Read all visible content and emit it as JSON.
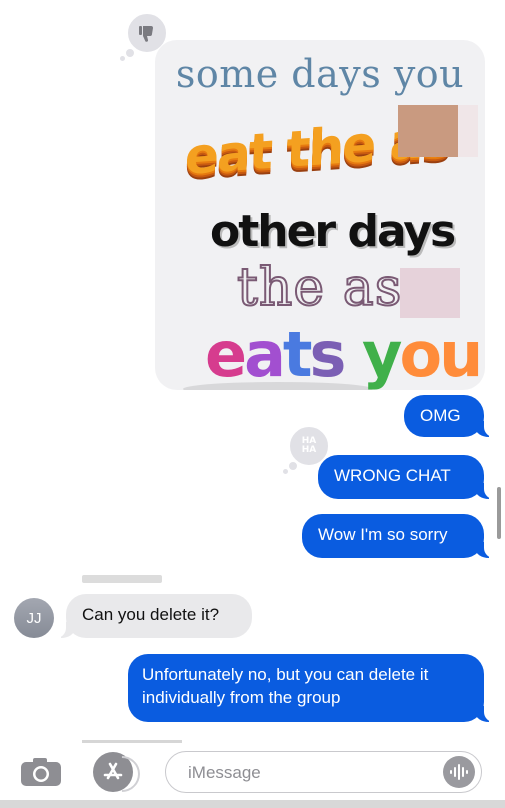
{
  "meme": {
    "line1": "some days you",
    "line2": "eat the as",
    "line3": "other days",
    "line4": "the as",
    "line5": [
      "e",
      "a",
      "t",
      "s",
      " ",
      "y",
      "ou"
    ]
  },
  "tapbacks": {
    "thumbs_down": "thumbs-down",
    "haha_top": "HA",
    "haha_bottom": "HA"
  },
  "messages": {
    "omg": "OMG",
    "wrong_chat": "WRONG CHAT",
    "sorry": "Wow I'm so sorry",
    "delete_question": "Can you delete it?",
    "unfortunately": "Unfortunately no, but you can delete it individually from the group"
  },
  "contact": {
    "initials": "JJ"
  },
  "compose": {
    "placeholder": "iMessage"
  },
  "colors": {
    "sent_bubble": "#0a5ce0",
    "received_bubble": "#e9e9eb",
    "tapback": "#e1e1e6"
  }
}
